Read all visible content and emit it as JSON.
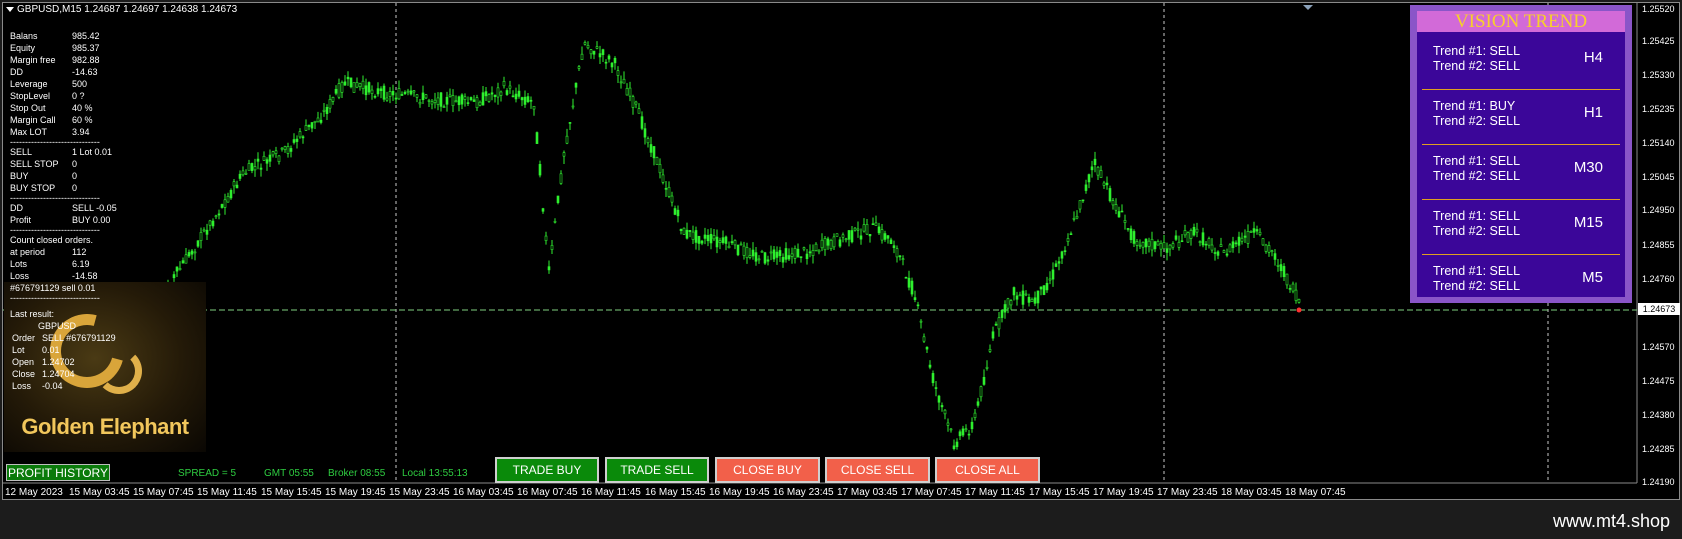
{
  "chart": {
    "symbol_line": "GBPUSD,M15  1.24687 1.24697 1.24638 1.24673",
    "colors": {
      "candle": "#2ff02f",
      "grid": "#c8c8c8",
      "bid": "#7fd07f",
      "background": "#000000"
    }
  },
  "account": [
    {
      "k": "Balans",
      "v": "985.42"
    },
    {
      "k": "Equity",
      "v": "985.37"
    },
    {
      "k": "Margin free",
      "v": "982.88"
    },
    {
      "k": "DD",
      "v": "-14.63"
    },
    {
      "k": "Leverage",
      "v": "500"
    },
    {
      "k": "StopLevel",
      "v": "0 ?"
    },
    {
      "k": "Stop Out",
      "v": "40 %"
    },
    {
      "k": "Margin Call",
      "v": "60 %"
    },
    {
      "k": "Max LOT",
      "v": "3.94"
    }
  ],
  "orders": [
    {
      "k": "SELL",
      "v": "1   Lot  0.01"
    },
    {
      "k": "SELL STOP",
      "v": "0"
    },
    {
      "k": "BUY",
      "v": "0"
    },
    {
      "k": "BUY STOP",
      "v": "0"
    }
  ],
  "dd_profit": [
    {
      "k": "DD",
      "v": "SELL  -0.05"
    },
    {
      "k": "Profit",
      "v": "BUY  0.00"
    }
  ],
  "closed": {
    "title": "Count closed orders.",
    "rows": [
      {
        "k": "at period",
        "v": "112"
      },
      {
        "k": "Lots",
        "v": "6.19"
      },
      {
        "k": "Loss",
        "v": "-14.58"
      }
    ],
    "last_ticket": "#676791129 sell 0.01"
  },
  "last_result": {
    "title": "Last result:",
    "symbol": "GBPUSD",
    "rows": [
      {
        "k": "Order",
        "v": "SELL  #676791129"
      },
      {
        "k": "Lot",
        "v": "0.01"
      },
      {
        "k": "Open",
        "v": "1.24702"
      },
      {
        "k": "Close",
        "v": "1.24704"
      },
      {
        "k": "Loss",
        "v": "-0.04"
      }
    ]
  },
  "logo": {
    "text": "Golden Elephant",
    "color": "#f2c75c"
  },
  "status": {
    "profit_history": "PROFIT HISTORY",
    "spread": "SPREAD = 5",
    "gmt": "GMT 05:55",
    "broker": "Broker 08:55",
    "local": "Local 13:55:13"
  },
  "trade_buttons": [
    {
      "label": "TRADE BUY",
      "color": "green"
    },
    {
      "label": "TRADE SELL",
      "color": "green"
    },
    {
      "label": "CLOSE BUY",
      "color": "red"
    },
    {
      "label": "CLOSE SELL",
      "color": "red"
    },
    {
      "label": "CLOSE ALL",
      "color": "red"
    }
  ],
  "vision_trend": {
    "title": "VISION TREND",
    "rows": [
      {
        "t1": "Trend #1: SELL",
        "t2": "Trend #2: SELL",
        "tf": "H4"
      },
      {
        "t1": "Trend #1: BUY",
        "t2": "Trend #2: SELL",
        "tf": "H1"
      },
      {
        "t1": "Trend #1: SELL",
        "t2": "Trend #2: SELL",
        "tf": "M30"
      },
      {
        "t1": "Trend #1: SELL",
        "t2": "Trend #2: SELL",
        "tf": "M15"
      },
      {
        "t1": "Trend #1: SELL",
        "t2": "Trend #2: SELL",
        "tf": "M5"
      }
    ]
  },
  "price_axis": [
    "1.25520",
    "1.25425",
    "1.25330",
    "1.25235",
    "1.25140",
    "1.25045",
    "1.24950",
    "1.24855",
    "1.24760",
    "1.24570",
    "1.24475",
    "1.24380",
    "1.24285",
    "1.24190"
  ],
  "current_price": "1.24673",
  "time_axis": [
    "12 May 2023",
    "15 May 03:45",
    "15 May 07:45",
    "15 May 11:45",
    "15 May 15:45",
    "15 May 19:45",
    "15 May 23:45",
    "16 May 03:45",
    "16 May 07:45",
    "16 May 11:45",
    "16 May 15:45",
    "16 May 19:45",
    "16 May 23:45",
    "17 May 03:45",
    "17 May 07:45",
    "17 May 11:45",
    "17 May 15:45",
    "17 May 19:45",
    "17 May 23:45",
    "18 May 03:45",
    "18 May 07:45"
  ],
  "footer": "www.mt4.shop"
}
